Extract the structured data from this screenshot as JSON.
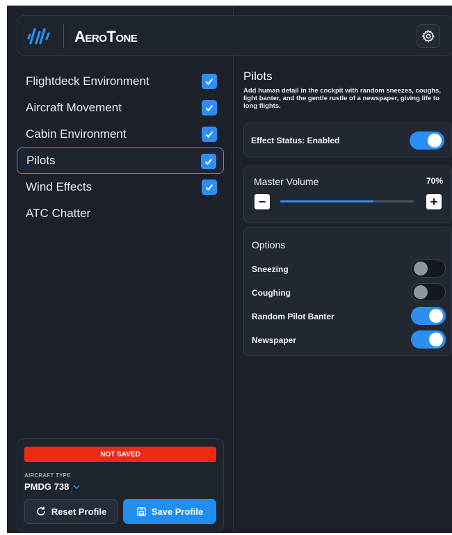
{
  "header": {
    "brand_name": "AeroTone",
    "settings_icon": "gear-icon"
  },
  "sidebar": {
    "items": [
      {
        "label": "Flightdeck Environment",
        "checked": true,
        "active": false
      },
      {
        "label": "Aircraft Movement",
        "checked": true,
        "active": false
      },
      {
        "label": "Cabin Environment",
        "checked": true,
        "active": false
      },
      {
        "label": "Pilots",
        "checked": true,
        "active": true
      },
      {
        "label": "Wind Effects",
        "checked": true,
        "active": false
      },
      {
        "label": "ATC Chatter",
        "checked": false,
        "active": false
      }
    ]
  },
  "profile": {
    "status_banner": "NOT SAVED",
    "aircraft_type_label": "AIRCRAFT TYPE",
    "aircraft_type_value": "PMDG 738",
    "reset_label": "Reset Profile",
    "save_label": "Save Profile"
  },
  "detail": {
    "title": "Pilots",
    "description": "Add human detail in the cockpit with random sneezes, coughs, light banter, and the gentle rustle of a newspaper, giving life to long flights.",
    "effect_status_label": "Effect Status: Enabled",
    "effect_status_on": true,
    "master_volume_label": "Master Volume",
    "master_volume_value": "70%",
    "master_volume_fraction": 0.7,
    "options_title": "Options",
    "options": [
      {
        "label": "Sneezing",
        "on": false
      },
      {
        "label": "Coughing",
        "on": false
      },
      {
        "label": "Random Pilot Banter",
        "on": true
      },
      {
        "label": "Newspaper",
        "on": true
      }
    ]
  },
  "colors": {
    "accent": "#2a8ef3",
    "background": "#1b2029",
    "warning": "#ee2a12"
  }
}
